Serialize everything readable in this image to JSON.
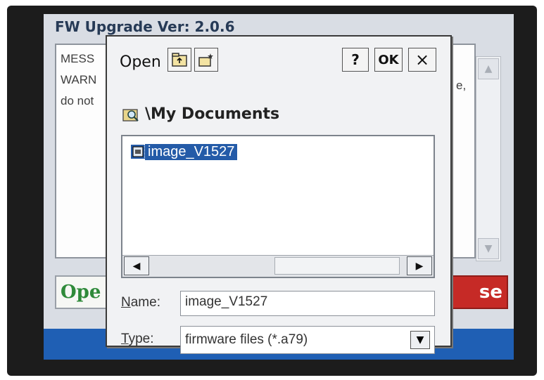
{
  "app": {
    "title": "FW Upgrade Ver: 2.0.6",
    "message_lines": [
      "MESS",
      "WARN",
      "do not"
    ],
    "message_tail": "e,",
    "open_button": "Ope",
    "close_button": "se"
  },
  "dialog": {
    "title": "Open",
    "help_label": "?",
    "ok_label": "OK",
    "close_label": "×",
    "location": "\\My Documents",
    "files": [
      {
        "name": "image_V1527",
        "selected": true
      }
    ],
    "name_label_u": "N",
    "name_label_rest": "ame:",
    "name_value": "image_V1527",
    "type_label_u": "T",
    "type_label_rest": "ype:",
    "type_value": "firmware files (*.a79)"
  },
  "icons": {
    "up_folder": "up-folder-icon",
    "new_folder": "new-folder-icon",
    "location": "folder-search-icon",
    "file": "file-icon",
    "scroll_left": "left-arrow-icon",
    "scroll_right": "right-arrow-icon",
    "dropdown": "chevron-down-icon"
  },
  "colors": {
    "taskbar": "#1f5fb4",
    "selection": "#245ba8",
    "open_button_text": "#2f8a3a",
    "close_button_bg": "#c62a26"
  }
}
